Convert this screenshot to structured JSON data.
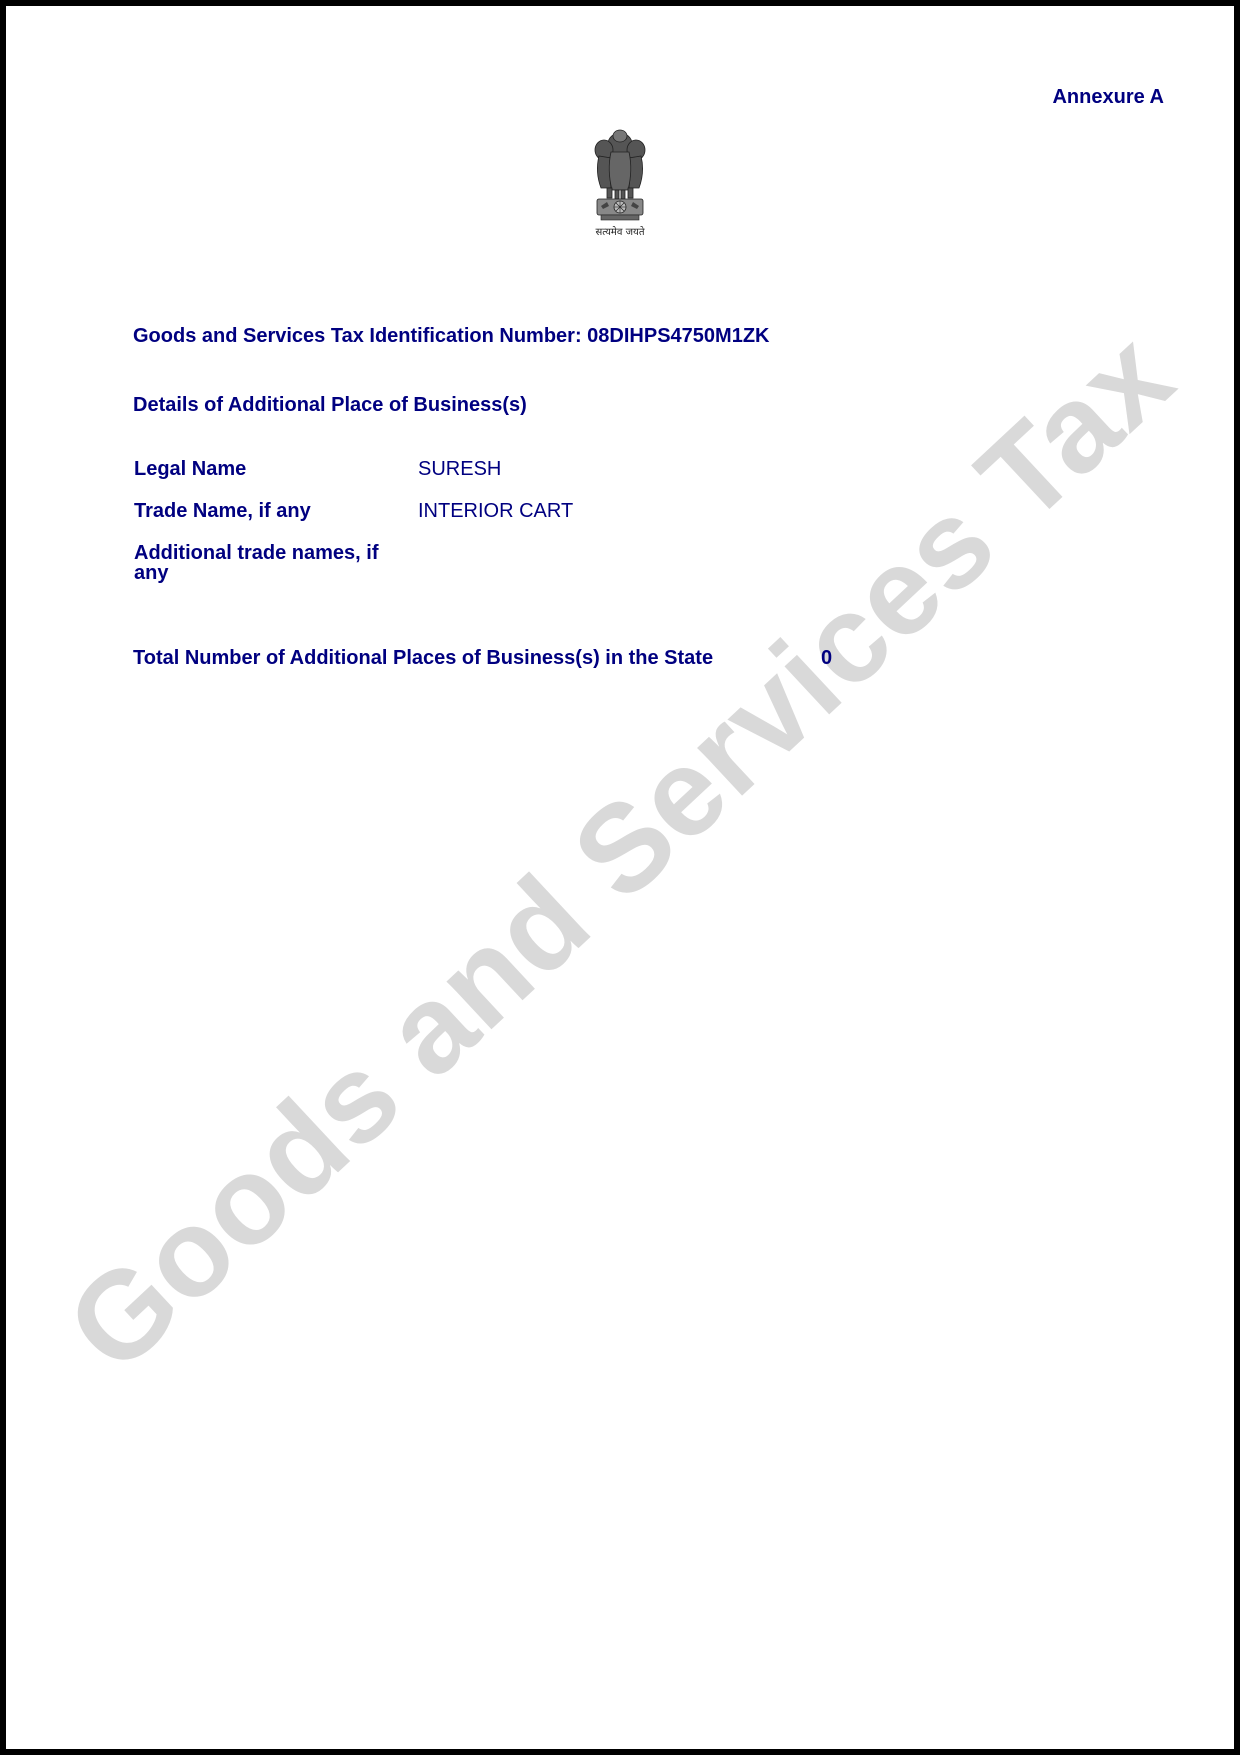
{
  "header": {
    "annexure": "Annexure A"
  },
  "emblem": {
    "motto": "सत्यमेव जयते"
  },
  "watermark": "Goods and Services Tax",
  "gstin": {
    "line": "Goods and Services Tax Identification Number: 08DIHPS4750M1ZK"
  },
  "section": {
    "heading": "Details of Additional Place of Business(s)"
  },
  "fields": [
    {
      "label": "Legal Name",
      "value": "SURESH"
    },
    {
      "label": "Trade Name, if any",
      "value": "INTERIOR CART"
    },
    {
      "label": "Additional trade names, if any",
      "value": ""
    }
  ],
  "total": {
    "label": "Total Number of Additional Places of Business(s) in the State",
    "value": "0"
  },
  "colors": {
    "text": "#000080",
    "watermark": "#d9d9d9",
    "border": "#000000"
  }
}
